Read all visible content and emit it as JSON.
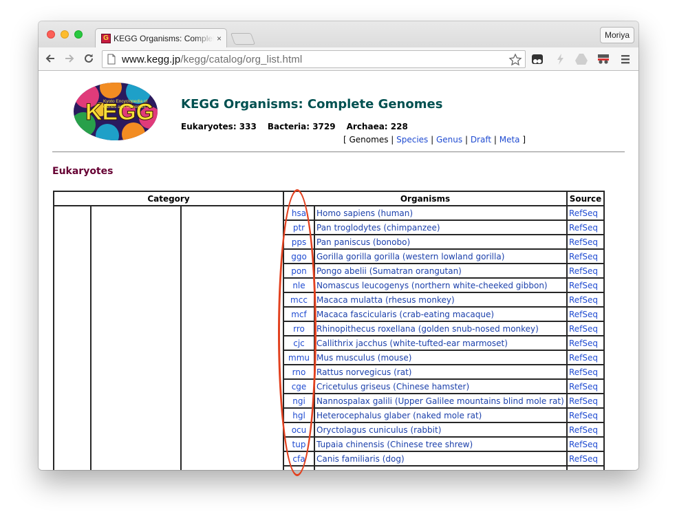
{
  "browser": {
    "tab_title": "KEGG Organisms: Complete Genomes",
    "tab_close": "×",
    "user_label": "Moriya",
    "url_host": "www.kegg.jp",
    "url_path": "/kegg/catalog/org_list.html",
    "icons": [
      "back-icon",
      "forward-icon",
      "reload-icon",
      "page-icon",
      "bookmark-star-icon",
      "extension-icon",
      "lightning-icon",
      "drive-icon",
      "incognito-icon",
      "menu-icon"
    ]
  },
  "header": {
    "logo_text": "KEGG",
    "logo_subtitle": "Kyoto Encyclopedia of Genes and Genomes",
    "title": "KEGG Organisms: Complete Genomes",
    "eukaryotes": "Eukaryotes: 333",
    "bacteria": "Bacteria: 3729",
    "archaea": "Archaea: 228",
    "nav": {
      "open": "[ ",
      "genomes": "Genomes",
      "sep": " | ",
      "species": "Species",
      "genus": "Genus",
      "draft": "Draft",
      "meta": "Meta",
      "close": " ]"
    }
  },
  "section_title": "Eukaryotes",
  "table": {
    "headers": {
      "category": "Category",
      "organisms": "Organisms",
      "source": "Source"
    },
    "rows": [
      {
        "code": "hsa",
        "name": "Homo sapiens (human)",
        "source": "RefSeq"
      },
      {
        "code": "ptr",
        "name": "Pan troglodytes (chimpanzee)",
        "source": "RefSeq"
      },
      {
        "code": "pps",
        "name": "Pan paniscus (bonobo)",
        "source": "RefSeq"
      },
      {
        "code": "ggo",
        "name": "Gorilla gorilla gorilla (western lowland gorilla)",
        "source": "RefSeq"
      },
      {
        "code": "pon",
        "name": "Pongo abelii (Sumatran orangutan)",
        "source": "RefSeq"
      },
      {
        "code": "nle",
        "name": "Nomascus leucogenys (northern white-cheeked gibbon)",
        "source": "RefSeq"
      },
      {
        "code": "mcc",
        "name": "Macaca mulatta (rhesus monkey)",
        "source": "RefSeq"
      },
      {
        "code": "mcf",
        "name": "Macaca fascicularis (crab-eating macaque)",
        "source": "RefSeq"
      },
      {
        "code": "rro",
        "name": "Rhinopithecus roxellana (golden snub-nosed monkey)",
        "source": "RefSeq"
      },
      {
        "code": "cjc",
        "name": "Callithrix jacchus (white-tufted-ear marmoset)",
        "source": "RefSeq"
      },
      {
        "code": "mmu",
        "name": "Mus musculus (mouse)",
        "source": "RefSeq"
      },
      {
        "code": "rno",
        "name": "Rattus norvegicus (rat)",
        "source": "RefSeq"
      },
      {
        "code": "cge",
        "name": "Cricetulus griseus (Chinese hamster)",
        "source": "RefSeq"
      },
      {
        "code": "ngi",
        "name": "Nannospalax galili (Upper Galilee mountains blind mole rat)",
        "source": "RefSeq"
      },
      {
        "code": "hgl",
        "name": "Heterocephalus glaber (naked mole rat)",
        "source": "RefSeq"
      },
      {
        "code": "ocu",
        "name": "Oryctolagus cuniculus (rabbit)",
        "source": "RefSeq"
      },
      {
        "code": "tup",
        "name": "Tupaia chinensis (Chinese tree shrew)",
        "source": "RefSeq"
      },
      {
        "code": "cfa",
        "name": "Canis familiaris (dog)",
        "source": "RefSeq"
      }
    ]
  },
  "colors": {
    "title": "#005050",
    "section": "#660033",
    "link": "#1f4bd1",
    "annotation": "#e2411f"
  }
}
